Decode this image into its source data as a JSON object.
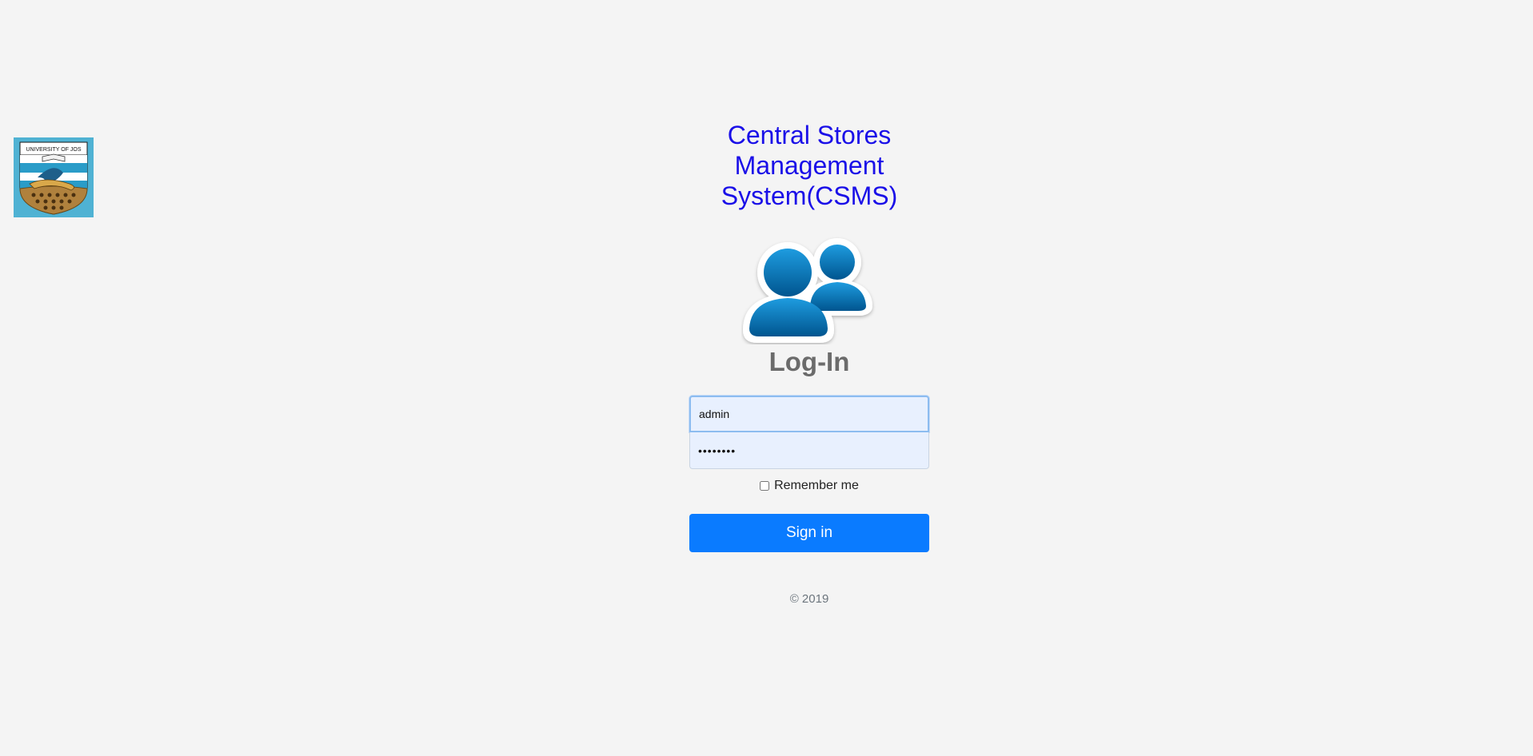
{
  "logo": {
    "icon": "university-of-jos-crest",
    "text": "UNIVERSITY OF JOS"
  },
  "app": {
    "title": "Central Stores Management System(CSMS)"
  },
  "login": {
    "graphic_icon": "users-icon",
    "heading": "Log-In",
    "username_value": "admin",
    "password_value": "••••••••",
    "remember_label": "Remember me",
    "remember_checked": false,
    "signin_label": "Sign in"
  },
  "footer": {
    "copyright": "© 2019"
  },
  "colors": {
    "background": "#f4f4f4",
    "title": "#1a0fe8",
    "button": "#0a7bff",
    "user_icon": "#0a5fa8"
  }
}
